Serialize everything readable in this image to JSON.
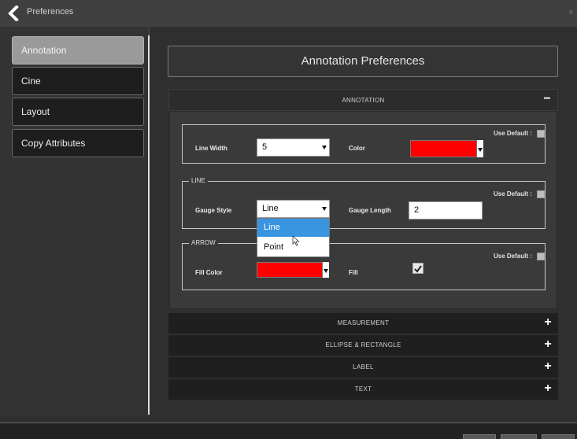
{
  "window": {
    "title": "Preferences"
  },
  "sidebar": {
    "items": [
      {
        "label": "Annotation"
      },
      {
        "label": "Cine"
      },
      {
        "label": "Layout"
      },
      {
        "label": "Copy Attributes"
      }
    ]
  },
  "main": {
    "header": "Annotation Preferences",
    "sections": [
      {
        "label": "ANNOTATION",
        "icon": "minus"
      },
      {
        "label": "MEASUREMENT",
        "icon": "plus"
      },
      {
        "label": "ELLIPSE & RECTANGLE",
        "icon": "plus"
      },
      {
        "label": "LABEL",
        "icon": "plus"
      },
      {
        "label": "TEXT",
        "icon": "plus"
      }
    ],
    "annotation": {
      "general": {
        "use_default": "Use Default :",
        "line_width_label": "Line Width",
        "line_width_value": "5",
        "color_label": "Color",
        "color_value": "#ff0000"
      },
      "line": {
        "legend": "LINE",
        "use_default": "Use Default :",
        "gauge_style_label": "Gauge Style",
        "gauge_style_value": "Line",
        "gauge_style_options": [
          "Line",
          "Point"
        ],
        "gauge_length_label": "Gauge Length",
        "gauge_length_value": "2"
      },
      "arrow": {
        "legend": "ARROW",
        "use_default": "Use Default :",
        "fill_color_label": "Fill Color",
        "fill_color_value": "#ff0000",
        "fill_label": "Fill",
        "fill_checked": true
      }
    }
  },
  "icons": {
    "back": "chevron-left-icon",
    "close": "close-icon",
    "collapse": "minus-icon",
    "expand": "plus-icon",
    "dropdown": "caret-down-icon",
    "check": "checkmark-icon"
  },
  "symbols": {
    "close": "×",
    "minus": "−",
    "plus": "+",
    "check": "✔"
  },
  "colors": {
    "accent": "#3a95e0",
    "swatch": "#ff0000"
  }
}
